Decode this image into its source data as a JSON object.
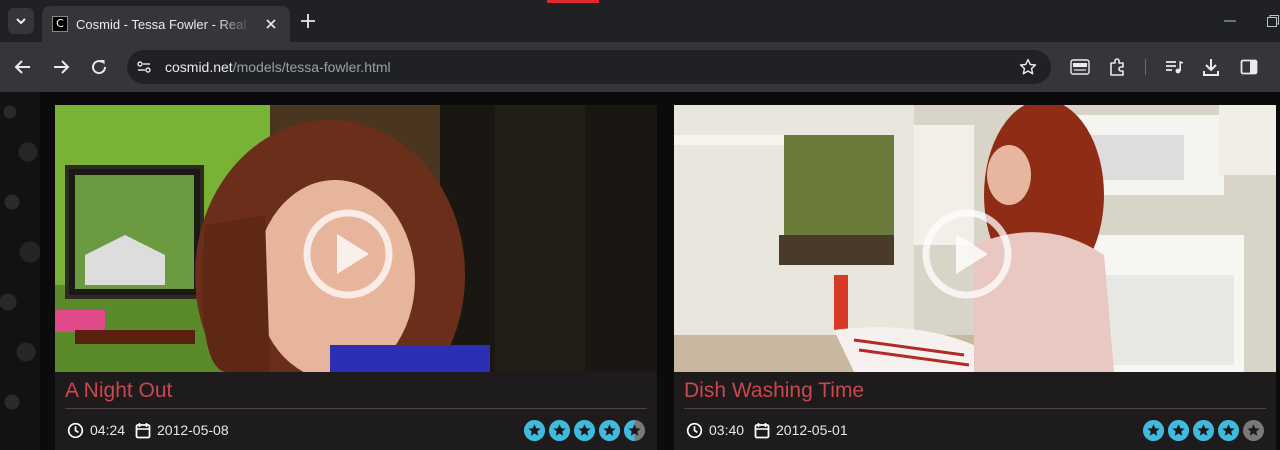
{
  "browser": {
    "tab": {
      "favicon": "C",
      "title": "Cosmid - Tessa Fowler - Real Beauty"
    },
    "url": {
      "host": "cosmid.net",
      "path": "/models/tessa-fowler.html"
    },
    "icons": [
      "tab-search-icon",
      "close-icon",
      "plus-icon",
      "back-icon",
      "forward-icon",
      "reload-icon",
      "site-info-icon",
      "bookmark-star-icon",
      "quality-badge-icon",
      "extensions-icon",
      "media-queue-icon",
      "download-icon",
      "side-panel-icon"
    ]
  },
  "videos": [
    {
      "title": "A Night Out",
      "duration": "04:24",
      "date": "2012-05-08",
      "rating": 4.5
    },
    {
      "title": "Dish Washing Time",
      "duration": "03:40",
      "date": "2012-05-01",
      "rating": 4
    }
  ],
  "colors": {
    "title": "#c9474d",
    "star": "#3fbbe0",
    "star_empty": "#7a7a7a"
  }
}
